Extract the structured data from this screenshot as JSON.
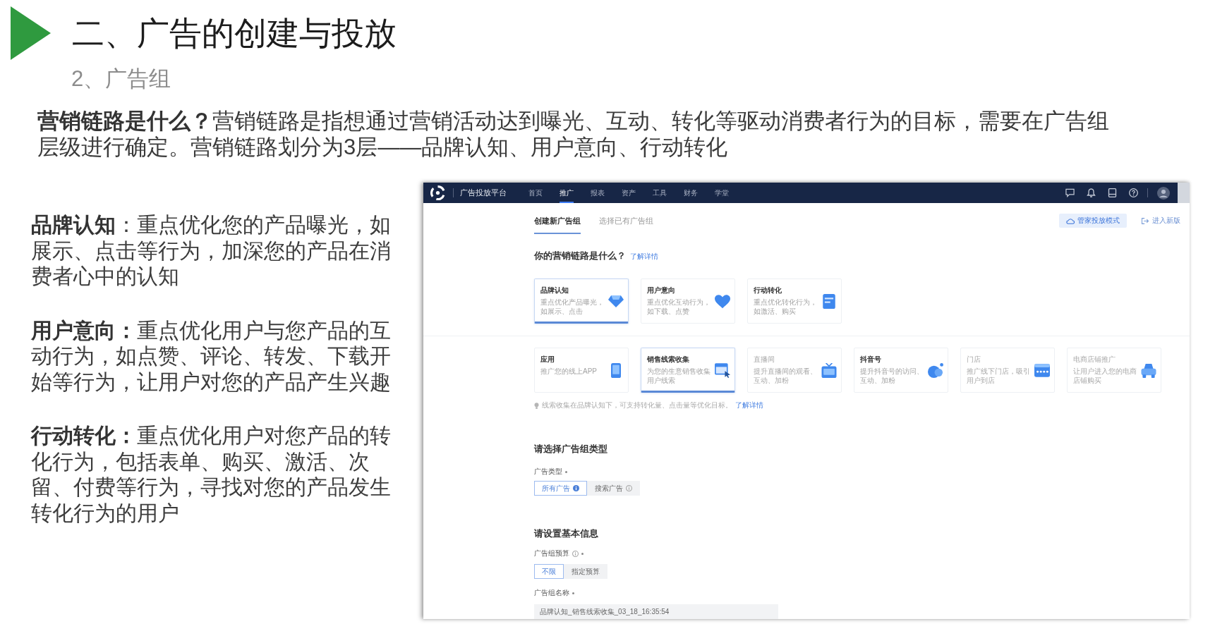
{
  "slide": {
    "title": "二、广告的创建与投放",
    "subtitle": "2、广告组",
    "intro": "**营销链路是什么？**营销链路是指想通过营销活动达到曝光、互动、转化等驱动消费者行为的目标，需要在广告组层级进行确定。营销链路划分为3层——品牌认知、用户意向、行动转化"
  },
  "definitions": [
    "**品牌认知**：重点优化您的产品曝光，如展示、点击等行为，加深您的产品在消费者心中的认知",
    "**用户意向：**重点优化用户与您产品的互动行为，如点赞、评论、转发、下载开始等行为，让用户对您的产品产生兴趣",
    "**行动转化：**重点优化用户对您产品的转化行为，包括表单、购买、激活、次留、付费等行为，寻找对您的产品发生转化行为的用户"
  ],
  "screenshot": {
    "nav": {
      "platform": "广告投放平台",
      "items": [
        {
          "label": "首页",
          "selected": false
        },
        {
          "label": "推广",
          "selected": true
        },
        {
          "label": "报表",
          "selected": false
        },
        {
          "label": "资产",
          "selected": false
        },
        {
          "label": "工具",
          "selected": false
        },
        {
          "label": "财务",
          "selected": false
        },
        {
          "label": "学堂",
          "selected": false
        }
      ]
    },
    "tabs": [
      {
        "label": "创建新广告组",
        "selected": true
      },
      {
        "label": "选择已有广告组",
        "selected": false
      }
    ],
    "actions": [
      {
        "kind": "button",
        "label": "管家投放模式"
      },
      {
        "kind": "link",
        "label": "进入新版"
      }
    ],
    "goal_heading": "你的营销链路是什么？",
    "goal_link": "了解详情",
    "goal_cards": [
      {
        "title": "品牌认知",
        "description": "重点优化产品曝光，如展示、点击",
        "selected": true,
        "disabled": false
      },
      {
        "title": "用户意向",
        "description": "重点优化互动行为，如下载、点赞",
        "selected": false,
        "disabled": false
      },
      {
        "title": "行动转化",
        "description": "重点优化转化行为，如激活、购买",
        "selected": false,
        "disabled": false
      }
    ],
    "target_cards": [
      {
        "title": "应用",
        "description": "推广您的线上APP",
        "selected": false,
        "disabled": false
      },
      {
        "title": "销售线索收集",
        "description": "为您的生意销售收集用户线索",
        "selected": true,
        "disabled": false
      },
      {
        "title": "直播间",
        "description": "提升直播间的观看、互动、加粉",
        "selected": false,
        "disabled": true
      },
      {
        "title": "抖音号",
        "description": "提升抖音号的访问、互动、加粉",
        "selected": false,
        "disabled": false
      },
      {
        "title": "门店",
        "description": "推广线下门店，吸引用户到店",
        "selected": false,
        "disabled": true
      },
      {
        "title": "电商店铺推广",
        "description": "让用户进入您的电商店铺购买",
        "selected": false,
        "disabled": true
      }
    ],
    "hint": {
      "text": "线索收集在品牌认知下，可支持转化量、点击量等优化目标。",
      "link": "了解详情"
    },
    "type_heading": "请选择广告组类型",
    "ad_type": {
      "label": "广告类型",
      "required": true,
      "options": [
        {
          "label": "所有广告",
          "selected": true,
          "info": true
        },
        {
          "label": "搜索广告",
          "selected": false,
          "info": true
        }
      ]
    },
    "basic_heading": "请设置基本信息",
    "budget": {
      "label": "广告组预算",
      "info": true,
      "required": true,
      "options": [
        {
          "label": "不限",
          "selected": true
        },
        {
          "label": "指定预算",
          "selected": false
        }
      ]
    },
    "name_field": {
      "label": "广告组名称",
      "required": true,
      "value": "品牌认知_销售线索收集_03_18_16:35:54"
    }
  }
}
